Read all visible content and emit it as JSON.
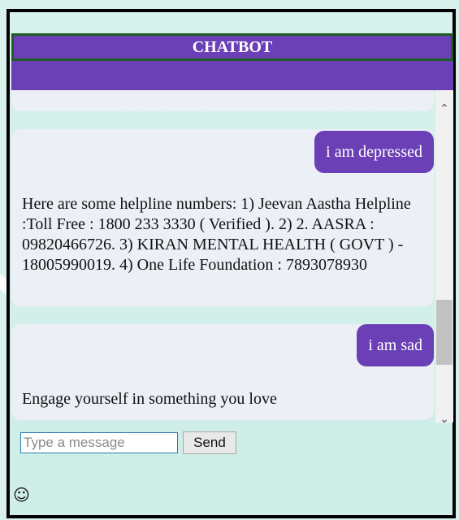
{
  "app": {
    "title": "CHATBOT"
  },
  "chat": {
    "messages": [
      {
        "role": "user",
        "text": "i am depressed"
      },
      {
        "role": "bot",
        "text": "Here are some helpline numbers: 1) Jeevan Aastha Helpline :Toll Free : 1800 233 3330 ( Verified ). 2) 2. AASRA : 09820466726. 3) KIRAN MENTAL HEALTH ( GOVT ) - 18005990019. 4) One Life Foundation : 7893078930"
      },
      {
        "role": "user",
        "text": "i am sad"
      },
      {
        "role": "bot",
        "text": "Engage yourself in something you love"
      }
    ]
  },
  "composer": {
    "placeholder": "Type a message",
    "value": "",
    "send_label": "Send"
  },
  "icons": {
    "scroll_up": "chevron-up-icon",
    "scroll_down": "chevron-down-icon",
    "emoji": "smiley-icon"
  },
  "colors": {
    "accent": "#6b3fb5",
    "title_border": "#1b5e20",
    "bubble_bg": "#eceff6",
    "page_bg": "#d9f1ec"
  }
}
